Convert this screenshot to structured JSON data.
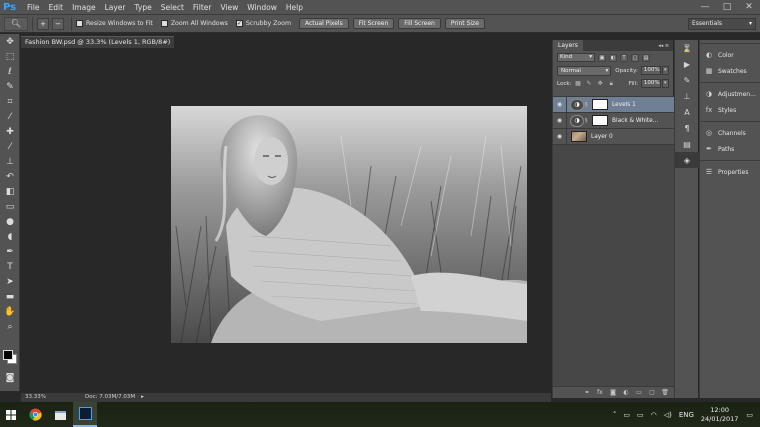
{
  "app": {
    "logo": "Ps"
  },
  "menu": [
    "File",
    "Edit",
    "Image",
    "Layer",
    "Type",
    "Select",
    "Filter",
    "View",
    "Window",
    "Help"
  ],
  "window_controls": {
    "minimize": "—",
    "maximize": "□",
    "close": "✕"
  },
  "options_bar": {
    "zoom_in": "+",
    "zoom_out": "−",
    "resize_windows": {
      "label": "Resize Windows to Fit",
      "checked": false
    },
    "zoom_all_windows": {
      "label": "Zoom All Windows",
      "checked": false
    },
    "scrubby_zoom": {
      "label": "Scrubby Zoom",
      "checked": true
    },
    "actual_pixels": "Actual Pixels",
    "fit_screen": "Fit Screen",
    "fill_screen": "Fill Screen",
    "print_size": "Print Size",
    "workspace": "Essentials"
  },
  "document": {
    "tab_title": "Fashion BW.psd @ 33.3% (Levels 1, RGB/8#) *",
    "tab_close": "×",
    "photo": "black-and-white photo of a blonde woman in a knit sweater lying in tall grass"
  },
  "status": {
    "zoom": "33.33%",
    "doc": "Doc: 7.03M/7.03M"
  },
  "layers_panel": {
    "tab": "Layers",
    "filter_kind": "Kind",
    "blend_mode": "Normal",
    "opacity_label": "Opacity:",
    "opacity": "100%",
    "lock_label": "Lock:",
    "fill_label": "Fill:",
    "fill": "100%",
    "layers": [
      {
        "name": "Levels 1",
        "selected": true
      },
      {
        "name": "Black & White...",
        "selected": false
      },
      {
        "name": "Layer 0",
        "selected": false
      }
    ]
  },
  "right_dock": {
    "groups": [
      [
        "Color",
        "Swatches"
      ],
      [
        "Adjustmen...",
        "Styles"
      ],
      [
        "Channels",
        "Paths"
      ],
      [
        "Properties"
      ]
    ]
  },
  "taskbar": {
    "language": "ENG",
    "time": "12:00",
    "date": "24/01/2017"
  },
  "colors": {
    "selected_layer": "#6f7f94",
    "panel": "#535353",
    "canvas_bg": "#282828"
  }
}
